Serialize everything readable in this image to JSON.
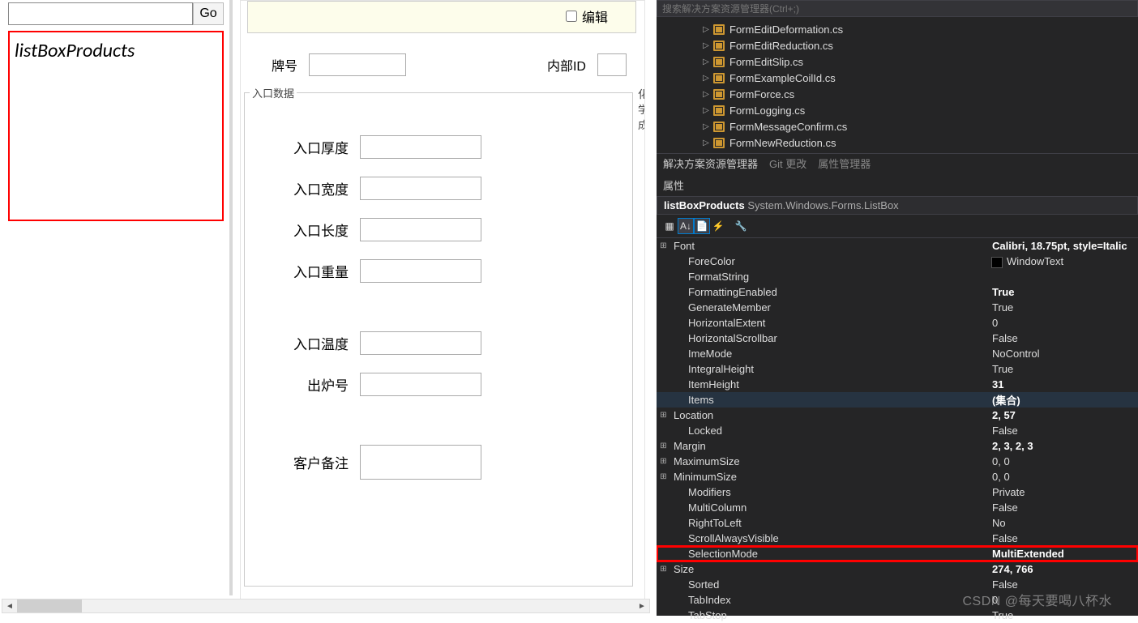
{
  "designer": {
    "go": "Go",
    "listboxName": "listBoxProducts",
    "edit": "编辑",
    "brandLabel": "牌号",
    "innerIdLabel": "内部ID",
    "group1": "入口数据",
    "group2": "化学成",
    "fields": {
      "thickness": "入口厚度",
      "width": "入口宽度",
      "length": "入口长度",
      "weight": "入口重量",
      "temp": "入口温度",
      "furnace": "出炉号",
      "remarks": "客户备注"
    }
  },
  "sePlaceholder": "搜索解决方案资源管理器(Ctrl+;)",
  "tree": [
    "FormEditDeformation.cs",
    "FormEditReduction.cs",
    "FormEditSlip.cs",
    "FormExampleCoilId.cs",
    "FormForce.cs",
    "FormLogging.cs",
    "FormMessageConfirm.cs",
    "FormNewReduction.cs"
  ],
  "tabs": {
    "sol": "解决方案资源管理器",
    "git": "Git 更改",
    "propmgr": "属性管理器"
  },
  "propsHeader": "属性",
  "objName": "listBoxProducts",
  "objType": "System.Windows.Forms.ListBox",
  "props": [
    {
      "k": "Font",
      "v": "Calibri, 18.75pt, style=Italic",
      "exp": "⊞",
      "bold": true
    },
    {
      "k": "ForeColor",
      "v": "WindowText",
      "swatch": true,
      "indent": true
    },
    {
      "k": "FormatString",
      "v": "",
      "indent": true
    },
    {
      "k": "FormattingEnabled",
      "v": "True",
      "indent": true,
      "bold": true
    },
    {
      "k": "GenerateMember",
      "v": "True",
      "indent": true
    },
    {
      "k": "HorizontalExtent",
      "v": "0",
      "indent": true
    },
    {
      "k": "HorizontalScrollbar",
      "v": "False",
      "indent": true
    },
    {
      "k": "ImeMode",
      "v": "NoControl",
      "indent": true
    },
    {
      "k": "IntegralHeight",
      "v": "True",
      "indent": true
    },
    {
      "k": "ItemHeight",
      "v": "31",
      "indent": true,
      "bold": true
    },
    {
      "k": "Items",
      "v": "(集合)",
      "indent": true,
      "bold": true,
      "selected": true
    },
    {
      "k": "Location",
      "v": "2, 57",
      "exp": "⊞",
      "bold": true
    },
    {
      "k": "Locked",
      "v": "False",
      "indent": true
    },
    {
      "k": "Margin",
      "v": "2, 3, 2, 3",
      "exp": "⊞",
      "bold": true
    },
    {
      "k": "MaximumSize",
      "v": "0, 0",
      "exp": "⊞"
    },
    {
      "k": "MinimumSize",
      "v": "0, 0",
      "exp": "⊞"
    },
    {
      "k": "Modifiers",
      "v": "Private",
      "indent": true
    },
    {
      "k": "MultiColumn",
      "v": "False",
      "indent": true
    },
    {
      "k": "RightToLeft",
      "v": "No",
      "indent": true
    },
    {
      "k": "ScrollAlwaysVisible",
      "v": "False",
      "indent": true
    },
    {
      "k": "SelectionMode",
      "v": "MultiExtended",
      "indent": true,
      "bold": true,
      "hl": true
    },
    {
      "k": "Size",
      "v": "274, 766",
      "exp": "⊞",
      "bold": true
    },
    {
      "k": "Sorted",
      "v": "False",
      "indent": true
    },
    {
      "k": "TabIndex",
      "v": "0",
      "indent": true
    },
    {
      "k": "TabStop",
      "v": "True",
      "indent": true
    }
  ],
  "watermark": "CSDN @每天要喝八杯水"
}
